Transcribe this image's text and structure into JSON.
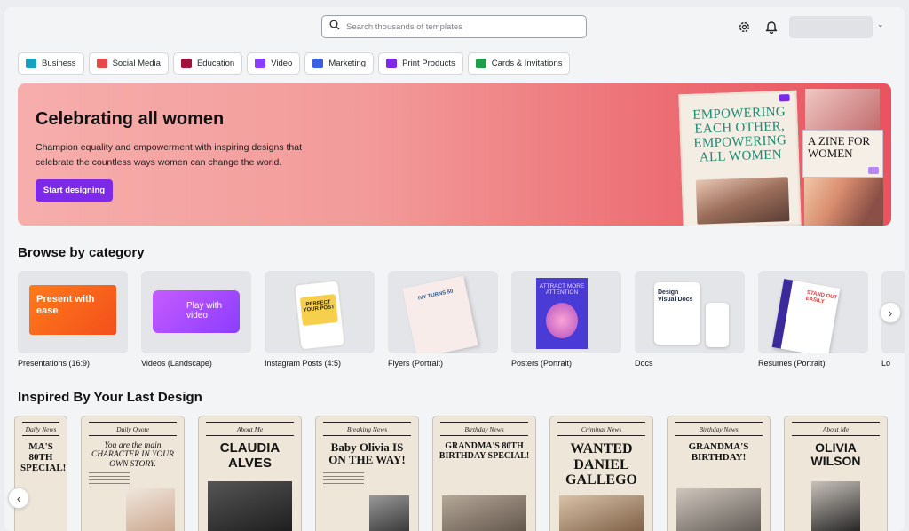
{
  "search": {
    "placeholder": "Search thousands of templates"
  },
  "categories_chips": [
    {
      "label": "Business",
      "color": "#15a1bf"
    },
    {
      "label": "Social Media",
      "color": "#e5484d"
    },
    {
      "label": "Education",
      "color": "#a0123c"
    },
    {
      "label": "Video",
      "color": "#8b3dff"
    },
    {
      "label": "Marketing",
      "color": "#3a5fe0"
    },
    {
      "label": "Print Products",
      "color": "#7d2ae8"
    },
    {
      "label": "Cards & Invitations",
      "color": "#1e9e4a"
    }
  ],
  "banner": {
    "title": "Celebrating all women",
    "description": "Champion equality and empowerment with inspiring designs that celebrate the countless ways women can change the world.",
    "cta": "Start designing",
    "zine_title": "EMPOWERING EACH OTHER, EMPOWERING ALL WOMEN",
    "zine_small_title": "A ZINE FOR WOMEN"
  },
  "browse": {
    "title": "Browse by category",
    "items": [
      {
        "label": "Presentations (16:9)",
        "thumb_text": "Present with ease"
      },
      {
        "label": "Videos (Landscape)",
        "thumb_text": "Play with video"
      },
      {
        "label": "Instagram Posts (4:5)",
        "thumb_text": "PERFECT YOUR POST"
      },
      {
        "label": "Flyers (Portrait)",
        "thumb_text": "IVY TURNS 50"
      },
      {
        "label": "Posters (Portrait)",
        "thumb_text": "ATTRACT MORE ATTENTION"
      },
      {
        "label": "Docs",
        "thumb_text": "Design Visual Docs"
      },
      {
        "label": "Resumes (Portrait)",
        "thumb_text": "STAND OUT EASILY"
      },
      {
        "label": "Lo",
        "thumb_text": ""
      }
    ]
  },
  "inspired": {
    "title": "Inspired By Your Last Design",
    "items": [
      {
        "masthead": "Daily News",
        "headline": "MA'S 80TH SPECIAL!"
      },
      {
        "masthead": "Daily Quote",
        "headline": "You are the main CHARACTER IN YOUR OWN STORY."
      },
      {
        "masthead": "About Me",
        "headline": "CLAUDIA ALVES"
      },
      {
        "masthead": "Breaking News",
        "headline": "Baby Olivia IS ON THE WAY!"
      },
      {
        "masthead": "Birthday News",
        "headline": "GRANDMA'S 80TH BIRTHDAY SPECIAL!"
      },
      {
        "masthead": "Criminal News",
        "headline": "WANTED DANIEL GALLEGO"
      },
      {
        "masthead": "Birthday News",
        "headline": "GRANDMA'S BIRTHDAY!"
      },
      {
        "masthead": "About Me",
        "headline": "OLIVIA WILSON"
      }
    ]
  },
  "colors": {
    "accent": "#7d2ae8"
  }
}
